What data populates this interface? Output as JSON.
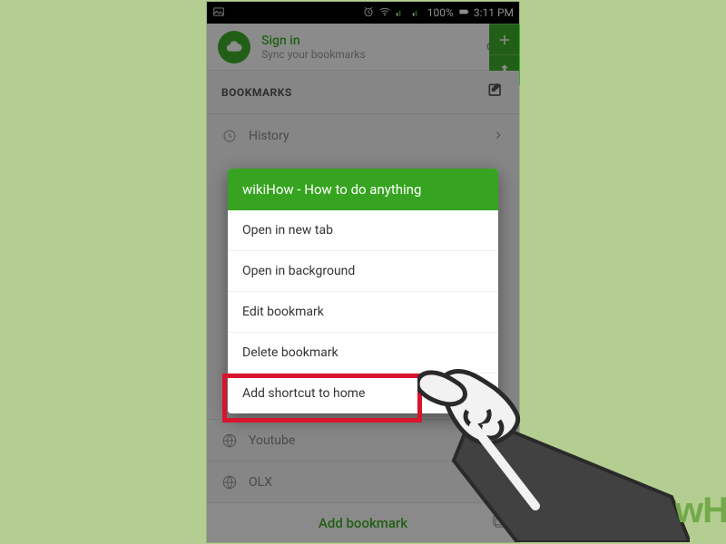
{
  "status": {
    "battery_pct": "100%",
    "time": "3:11 PM"
  },
  "header": {
    "signin": "Sign in",
    "sync": "Sync your bookmarks"
  },
  "bookmarks": {
    "section_title": "BOOKMARKS",
    "history": "History",
    "items": [
      "Youtube",
      "OLX"
    ],
    "add": "Add bookmark"
  },
  "popup": {
    "title": "wikiHow - How to do anything",
    "items": [
      "Open in new tab",
      "Open in background",
      "Edit bookmark",
      "Delete bookmark",
      "Add shortcut to home"
    ]
  },
  "watermark": "wH"
}
